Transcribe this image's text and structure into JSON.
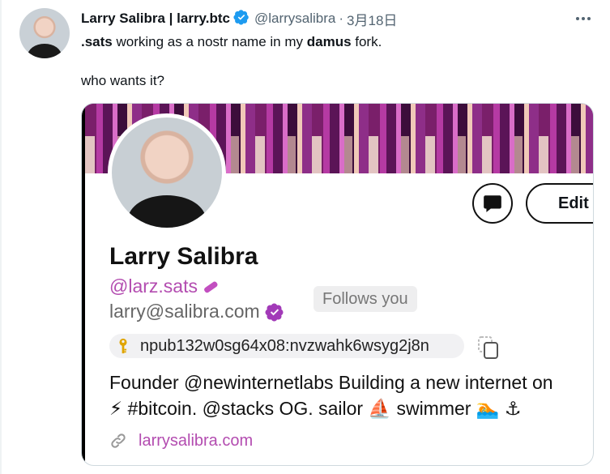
{
  "tweet": {
    "author_name": "Larry Salibra | larry.btc",
    "handle": "@larrysalibra",
    "separator": "·",
    "date": "3月18日",
    "text_line1_bold1": ".sats",
    "text_line1_mid": " working as a nostr name in my ",
    "text_line1_bold2": "damus",
    "text_line1_end": " fork.",
    "text_line2": "who wants it?"
  },
  "embedded_profile": {
    "display_name": "Larry Salibra",
    "nostr_name": "@larz.sats",
    "follows_badge": "Follows you",
    "nip05": "larry@salibra.com",
    "npub": "npub132w0sg64x08:nvzwahk6wsyg2j8n",
    "edit_label": "Edit",
    "bio_line1": "Founder @newinternetlabs Building a new internet on",
    "bio_line2": "⚡ #bitcoin. @stacks OG. sailor ⛵ swimmer 🏊 ⚓",
    "website": "larrysalibra.com"
  },
  "colors": {
    "verified_blue": "#1d9bf0",
    "nostr_purple": "#b34cb0",
    "muted_text": "#536471"
  },
  "icons": [
    "verified-badge-icon",
    "more-options-icon",
    "message-bubble-icon",
    "pencil-icon",
    "verified-purple-icon",
    "key-icon",
    "copy-icon",
    "link-icon"
  ]
}
